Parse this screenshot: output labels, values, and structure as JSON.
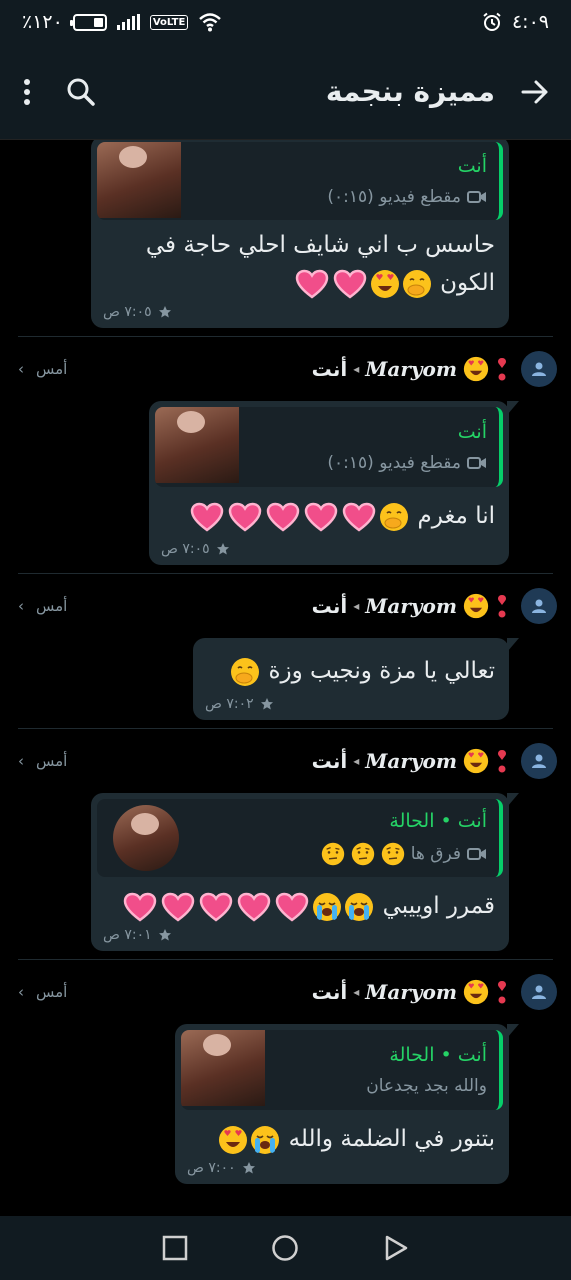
{
  "status": {
    "time": "٤:٠٩",
    "battery": "٪١٢٠",
    "volte": "VoLTE"
  },
  "appbar": {
    "title": "مميزة بنجمة"
  },
  "common": {
    "you": "أنت",
    "yesterday": "أمس",
    "sender_name": "Maryom"
  },
  "messages": [
    {
      "quote_title": "أنت",
      "quote_sub": "مقطع فيديو (٠:١٥)",
      "text": "حاسس ب اني شايف احلي حاجة في الكون",
      "time": "٧:٠٥ ص"
    },
    {
      "quote_title": "أنت",
      "quote_sub": "مقطع فيديو (٠:١٥)",
      "text": "انا مغرم",
      "time": "٧:٠٥ ص"
    },
    {
      "text": "تعالي يا مزة ونجيب وزة",
      "time": "٧:٠٢ ص"
    },
    {
      "quote_title": "أنت • الحالة",
      "quote_sub": "فرق ها",
      "text": "قمرر اوييبي",
      "time": "٧:٠١ ص"
    },
    {
      "quote_title": "أنت • الحالة",
      "quote_sub": "والله بجد يجدعان",
      "text": "بتنور في الضلمة والله",
      "time": "٧:٠٠ ص"
    }
  ],
  "icons": {
    "back": "arrow-right-icon",
    "search": "search-icon",
    "menu": "more-vertical-icon",
    "star": "star-icon",
    "video": "video-icon"
  }
}
